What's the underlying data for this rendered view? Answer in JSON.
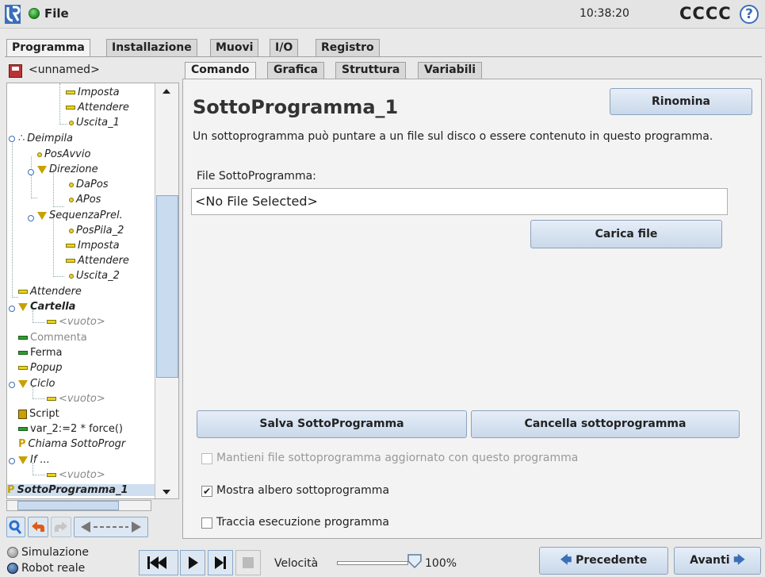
{
  "header": {
    "file_label": "File",
    "clock": "10:38:20",
    "robot_name": "CCCC",
    "help_label": "?"
  },
  "main_tabs": [
    "Programma",
    "Installazione",
    "Muovi",
    "I/O",
    "Registro"
  ],
  "left_panel": {
    "program_name": "<unnamed>",
    "tree": [
      {
        "label": "Imposta",
        "icon": "set-icon"
      },
      {
        "label": "Attendere",
        "icon": "wait-icon"
      },
      {
        "label": "Uscita_1",
        "icon": "waypoint-icon"
      },
      {
        "label": "Deimpila",
        "icon": "pallet-icon"
      },
      {
        "label": "PosAvvio",
        "icon": "waypoint-icon"
      },
      {
        "label": "Direzione",
        "icon": "folder-icon"
      },
      {
        "label": "DaPos",
        "icon": "waypoint-icon"
      },
      {
        "label": "APos",
        "icon": "waypoint-icon"
      },
      {
        "label": "SequenzaPrel.",
        "icon": "folder-icon"
      },
      {
        "label": "PosPila_2",
        "icon": "waypoint-icon"
      },
      {
        "label": "Imposta",
        "icon": "set-icon"
      },
      {
        "label": "Attendere",
        "icon": "wait-icon"
      },
      {
        "label": "Uscita_2",
        "icon": "waypoint-icon"
      },
      {
        "label": "Attendere",
        "icon": "wait-icon"
      },
      {
        "label": "Cartella",
        "icon": "folder-icon"
      },
      {
        "label": "<vuoto>",
        "icon": "empty-icon"
      },
      {
        "label": "Commenta",
        "icon": "comment-icon"
      },
      {
        "label": "Ferma",
        "icon": "halt-icon"
      },
      {
        "label": "Popup",
        "icon": "popup-icon"
      },
      {
        "label": "Ciclo",
        "icon": "loop-icon"
      },
      {
        "label": "<vuoto>",
        "icon": "empty-icon"
      },
      {
        "label": "Script",
        "icon": "script-icon"
      },
      {
        "label": "var_2:=2 * force()",
        "icon": "assignment-icon"
      },
      {
        "label": "Chiama SottoProgr",
        "icon": "call-icon"
      },
      {
        "label": "If ...",
        "icon": "if-icon"
      },
      {
        "label": "<vuoto>",
        "icon": "empty-icon"
      },
      {
        "label": "SottoProgramma_1",
        "icon": "subprogram-icon"
      }
    ]
  },
  "sub_tabs": [
    "Comando",
    "Grafica",
    "Struttura",
    "Variabili"
  ],
  "command": {
    "title": "SottoProgramma_1",
    "rename_button": "Rinomina",
    "description": "Un sottoprogramma può puntare a un file sul disco o essere contenuto in questo programma.",
    "file_label": "File SottoProgramma:",
    "file_value": "<No File Selected>",
    "load_button": "Carica file",
    "save_button": "Salva SottoProgramma",
    "delete_button": "Cancella sottoprogramma",
    "keep_updated_label": "Mantieni file sottoprogramma aggiornato con questo programma",
    "keep_updated_checked": false,
    "show_tree_label": "Mostra albero sottoprogramma",
    "show_tree_checked": true,
    "trace_label": "Traccia esecuzione programma",
    "trace_checked": false
  },
  "bottom": {
    "simulation_label": "Simulazione",
    "real_robot_label": "Robot reale",
    "speed_label": "Velocità",
    "speed_value": "100%",
    "prev_button": "Precedente",
    "next_button": "Avanti"
  }
}
